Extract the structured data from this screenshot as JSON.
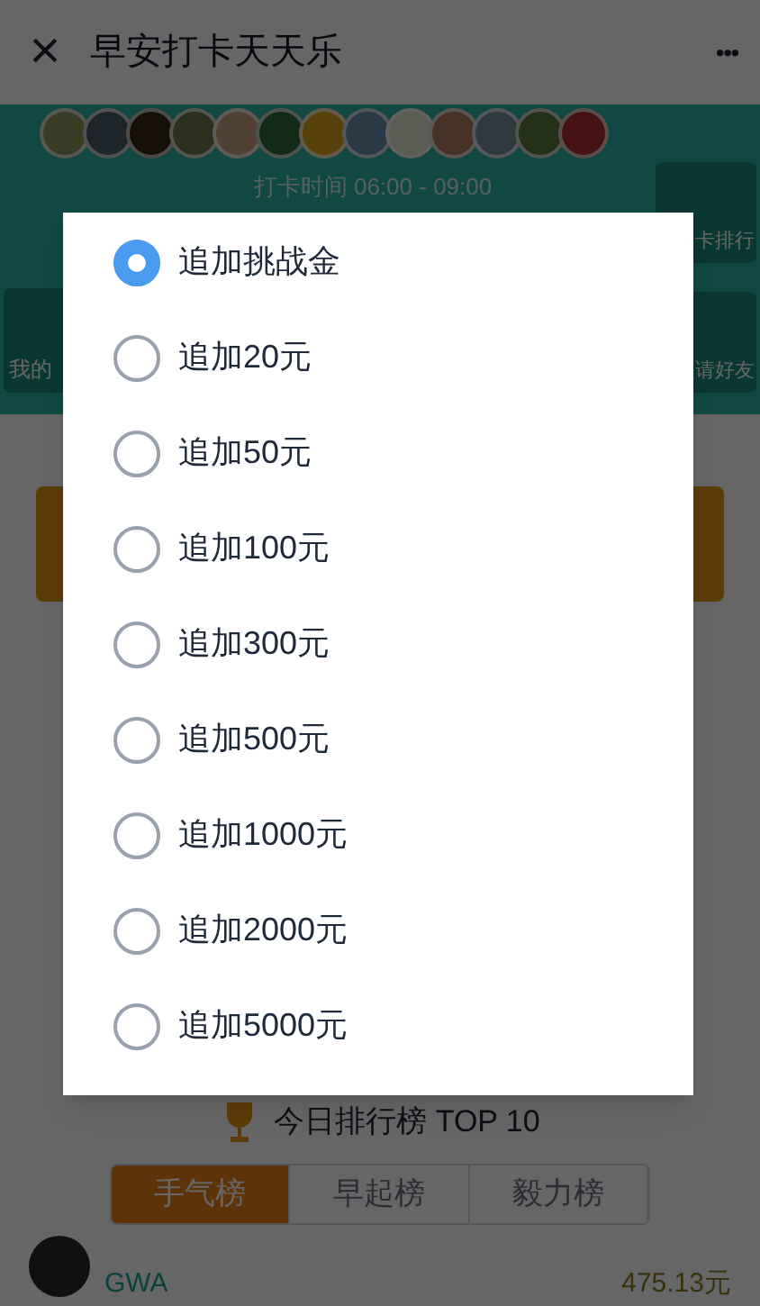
{
  "header": {
    "close_icon": "×",
    "title": "早安打卡天天乐",
    "more_icon": "•••"
  },
  "banner": {
    "checkin_time": "打卡时间 06:00 - 09:00",
    "left_button": "我的",
    "right_buttons": [
      "卡排行",
      "请好友"
    ]
  },
  "ranking": {
    "title": "今日排行榜 TOP 10",
    "tabs": [
      {
        "label": "手气榜",
        "selected": true
      },
      {
        "label": "早起榜",
        "selected": false
      },
      {
        "label": "毅力榜",
        "selected": false
      }
    ],
    "rows": [
      {
        "name": "GWA",
        "amount": "475.13元"
      }
    ]
  },
  "dialog": {
    "options": [
      {
        "label": "追加挑战金",
        "selected": true
      },
      {
        "label": "追加20元",
        "selected": false
      },
      {
        "label": "追加50元",
        "selected": false
      },
      {
        "label": "追加100元",
        "selected": false
      },
      {
        "label": "追加300元",
        "selected": false
      },
      {
        "label": "追加500元",
        "selected": false
      },
      {
        "label": "追加1000元",
        "selected": false
      },
      {
        "label": "追加2000元",
        "selected": false
      },
      {
        "label": "追加5000元",
        "selected": false
      }
    ]
  }
}
